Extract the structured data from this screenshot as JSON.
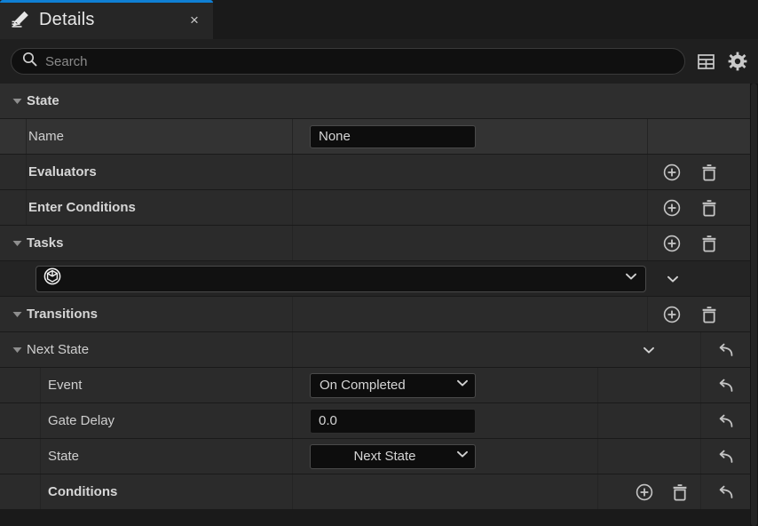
{
  "window": {
    "tab_title": "Details",
    "tab_icon": "details-pencil-icon",
    "close_label": "×"
  },
  "search": {
    "placeholder": "Search",
    "value": "",
    "search_icon": "search-icon",
    "column_settings_icon": "table-columns-icon",
    "settings_icon": "gear-icon"
  },
  "sections": {
    "state": {
      "label": "State",
      "expanded": true,
      "name_row": {
        "label": "Name",
        "value": "None"
      },
      "evaluators": {
        "label": "Evaluators",
        "add_icon": "plus-circle-icon",
        "delete_icon": "trash-icon"
      },
      "enter_conditions": {
        "label": "Enter Conditions",
        "add_icon": "plus-circle-icon",
        "delete_icon": "trash-icon"
      },
      "tasks": {
        "label": "Tasks",
        "expanded": true,
        "add_icon": "plus-circle-icon",
        "delete_icon": "trash-icon",
        "entry": {
          "class_icon": "cube-class-icon",
          "value": "",
          "picker_chevron": "chevron-down-icon",
          "row_chevron": "chevron-down-icon"
        }
      },
      "transitions": {
        "label": "Transitions",
        "expanded": true,
        "add_icon": "plus-circle-icon",
        "delete_icon": "trash-icon",
        "next_state": {
          "label": "Next State",
          "expanded": true,
          "chevron": "chevron-down-icon",
          "reset_icon": "reset-arrow-icon",
          "fields": [
            {
              "label": "Event",
              "type": "combo",
              "value": "On Completed",
              "align": "left"
            },
            {
              "label": "Gate Delay",
              "type": "text",
              "value": "0.0",
              "align": "left"
            },
            {
              "label": "State",
              "type": "combo",
              "value": "Next State",
              "align": "center"
            }
          ],
          "conditions": {
            "label": "Conditions",
            "add_icon": "plus-circle-icon",
            "delete_icon": "trash-icon",
            "reset_icon": "reset-arrow-icon"
          }
        }
      }
    }
  },
  "colors": {
    "accent": "#0f7fd4",
    "panel_bg": "#1a1a1a",
    "row_bg": "#2b2b2b",
    "row_alt_bg": "#333333",
    "field_bg": "#0d0d0d",
    "text": "#cfcfcf"
  }
}
